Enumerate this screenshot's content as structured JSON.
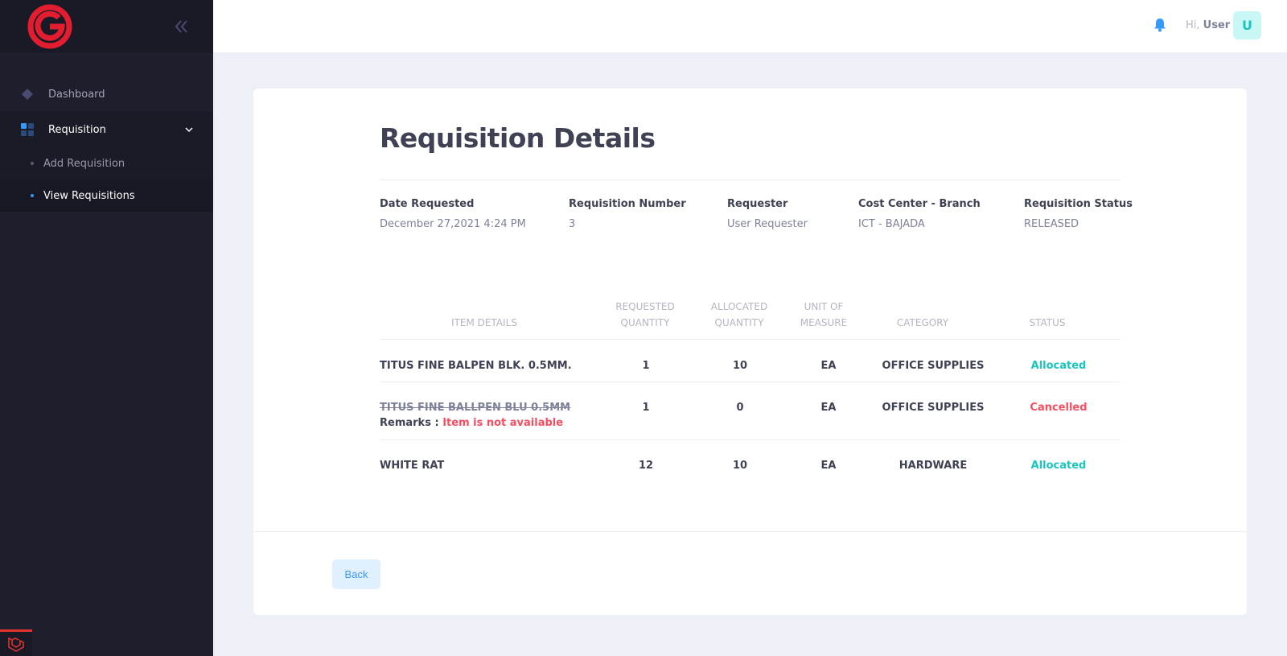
{
  "sidebar": {
    "items": [
      {
        "label": "Dashboard"
      },
      {
        "label": "Requisition"
      }
    ],
    "subitems": [
      {
        "label": "Add Requisition"
      },
      {
        "label": "View Requisitions"
      }
    ]
  },
  "header": {
    "greeting": "Hi,",
    "user_name": "User",
    "avatar_initial": "U"
  },
  "page": {
    "title": "Requisition Details"
  },
  "details": {
    "date_label": "Date Requested",
    "date_value": "December 27,2021 4:24 PM",
    "number_label": "Requisition Number",
    "number_value": "3",
    "requester_label": "Requester",
    "requester_value": "User Requester",
    "cost_label": "Cost Center - Branch",
    "cost_value": "ICT - BAJADA",
    "status_label": "Requisition Status",
    "status_value": "RELEASED"
  },
  "table": {
    "headers": [
      "Item Details",
      "Requested Quantity",
      "Allocated Quantity",
      "Unit of Measure",
      "Category",
      "Status"
    ],
    "rows": [
      {
        "item": "TITUS FINE BALPEN BLK. 0.5MM.",
        "requested": "1",
        "allocated": "10",
        "uom": "EA",
        "category": "OFFICE SUPPLIES",
        "status": "Allocated"
      },
      {
        "item": "TITUS FINE BALLPEN BLU 0.5MM",
        "remarks_label": "Remarks :",
        "remarks_value": "Item is not available",
        "requested": "1",
        "allocated": "0",
        "uom": "EA",
        "category": "OFFICE SUPPLIES",
        "status": "Cancelled"
      },
      {
        "item": "WHITE RAT",
        "requested": "12",
        "allocated": "10",
        "uom": "EA",
        "category": "HARDWARE",
        "status": "Allocated"
      }
    ]
  },
  "footer": {
    "back_label": "Back"
  },
  "colors": {
    "sidebar_bg": "#1e1e2d",
    "brand_red": "#e11d2f",
    "primary": "#3699ff",
    "success": "#1bc5bd",
    "danger": "#f64e60"
  },
  "icons": [
    "logo-icon",
    "collapse-icon",
    "dashboard-icon",
    "requisition-icon",
    "chevron-down-icon",
    "bell-icon",
    "laravel-icon"
  ]
}
